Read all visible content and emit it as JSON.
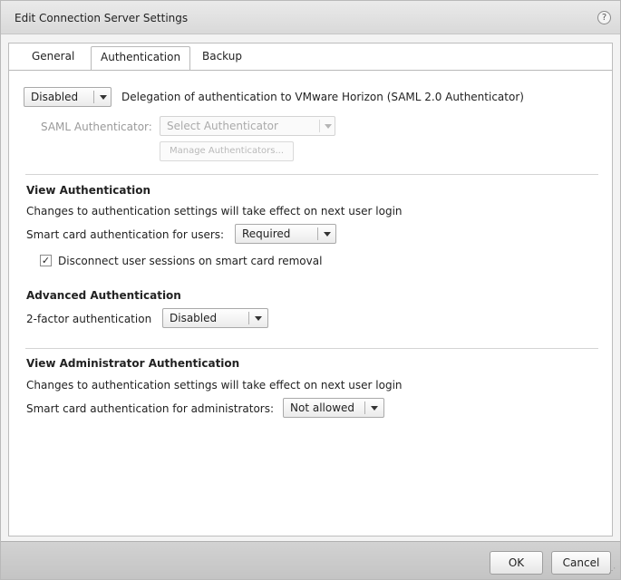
{
  "window": {
    "title": "Edit Connection Server Settings",
    "help_glyph": "?"
  },
  "tabs": [
    {
      "label": "General",
      "active": false
    },
    {
      "label": "Authentication",
      "active": true
    },
    {
      "label": "Backup",
      "active": false
    }
  ],
  "delegation": {
    "selected": "Disabled",
    "description": "Delegation of authentication to VMware Horizon (SAML 2.0 Authenticator)",
    "saml_label": "SAML Authenticator:",
    "saml_placeholder": "Select Authenticator",
    "manage_button": "Manage Authenticators..."
  },
  "view_auth": {
    "heading": "View Authentication",
    "note": "Changes to authentication settings will take effect on next user login",
    "smart_card_label": "Smart card authentication for users:",
    "smart_card_value": "Required",
    "disconnect_label": "Disconnect user sessions on smart card removal",
    "disconnect_checked": true
  },
  "advanced_auth": {
    "heading": "Advanced Authentication",
    "two_factor_label": "2-factor authentication",
    "two_factor_value": "Disabled"
  },
  "admin_auth": {
    "heading": "View Administrator Authentication",
    "note": "Changes to authentication settings will take effect on next user login",
    "smart_card_label": "Smart card authentication for administrators:",
    "smart_card_value": "Not allowed"
  },
  "footer": {
    "ok_label": "OK",
    "cancel_label": "Cancel"
  },
  "colors": {
    "dialog_bg": "#f3f3f3",
    "panel_bg": "#ffffff",
    "footer_bg": "#c9c9c9",
    "disabled_text": "#aaaaaa"
  }
}
